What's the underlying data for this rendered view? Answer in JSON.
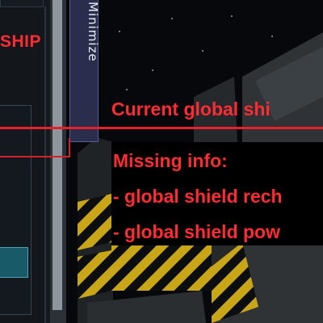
{
  "ship_panel": {
    "label": "SHIP"
  },
  "minimize_tab": {
    "label": "Minimize"
  },
  "annotation": {
    "current_label": "Current global shi",
    "missing_header": "Missing info:",
    "missing_items": [
      "- global shield rech",
      "- global shield pow"
    ],
    "color": "#ff2b33"
  },
  "colors": {
    "space": "#07080b",
    "minimize_tab_bg": "#2a2d4c",
    "hazard_yellow": "#c9a617",
    "hull_grey": "#2f3336"
  },
  "icons": [
    "hazard-stripe-pattern"
  ]
}
